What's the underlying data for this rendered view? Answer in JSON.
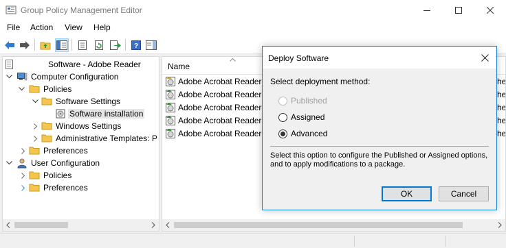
{
  "window": {
    "title": "Group Policy Management Editor"
  },
  "menu": [
    "File",
    "Action",
    "View",
    "Help"
  ],
  "toolbar": {
    "icons": [
      "back-arrow-icon",
      "forward-arrow-icon",
      "up-folder-icon",
      "show-hide-tree-icon",
      "properties-icon",
      "refresh-icon",
      "export-list-icon",
      "help-icon",
      "show-hide-action-pane-icon"
    ]
  },
  "tree": {
    "root": "Software - Adobe Reader",
    "items": [
      "Computer Configuration",
      "Policies",
      "Software Settings",
      "Software installation",
      "Windows Settings",
      "Administrative Templates: P",
      "Preferences",
      "User Configuration",
      "Policies",
      "Preferences"
    ]
  },
  "list": {
    "column_name": "Name",
    "rows": [
      "Adobe Acrobat Reader",
      "Adobe Acrobat Reader",
      "Adobe Acrobat Reader",
      "Adobe Acrobat Reader",
      "Adobe Acrobat Reader"
    ],
    "right_fragments": [
      "he",
      "he",
      "he",
      "he",
      "he"
    ]
  },
  "dialog": {
    "title": "Deploy Software",
    "prompt": "Select deployment method:",
    "options": [
      "Published",
      "Assigned",
      "Advanced"
    ],
    "selected": "Advanced",
    "description": "Select this option to configure the Published or Assigned options, and to apply modifications to a package.",
    "ok_label": "OK",
    "cancel_label": "Cancel"
  },
  "colors": {
    "accent": "#0078d7",
    "selection": "#e5e5e5",
    "folder": "#f4c551"
  }
}
